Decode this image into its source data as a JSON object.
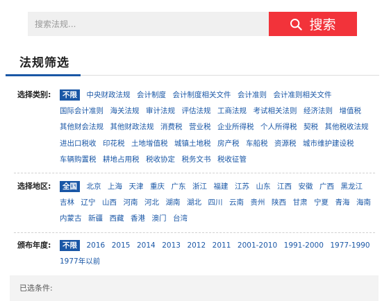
{
  "search": {
    "placeholder": "搜索法规...",
    "button_label": "搜索"
  },
  "filter_title": "法规筛选",
  "categories": {
    "label": "选择类别:",
    "options": [
      "不限",
      "中央财政法规",
      "会计制度",
      "会计制度相关文件",
      "会计准则",
      "会计准则相关文件",
      "国际会计准则",
      "海关法规",
      "审计法规",
      "评估法规",
      "工商法规",
      "考试相关法则",
      "经济法则",
      "增值税",
      "其他财会法规",
      "其他财政法规",
      "消费税",
      "营业税",
      "企业所得税",
      "个人所得税",
      "契税",
      "其他税收法规",
      "进出口税收",
      "印花税",
      "土地增值税",
      "城镇土地税",
      "房产税",
      "车船税",
      "资源税",
      "城市维护建设税",
      "车辆购置税",
      "耕地占用税",
      "税收协定",
      "税务文书",
      "税收征管"
    ],
    "selected": "不限"
  },
  "regions": {
    "label": "选择地区:",
    "options": [
      "全国",
      "北京",
      "上海",
      "天津",
      "重庆",
      "广东",
      "浙江",
      "福建",
      "江苏",
      "山东",
      "江西",
      "安徽",
      "广西",
      "黑龙江",
      "吉林",
      "辽宁",
      "山西",
      "河南",
      "河北",
      "湖南",
      "湖北",
      "四川",
      "云南",
      "贵州",
      "陕西",
      "甘肃",
      "宁夏",
      "青海",
      "海南",
      "内蒙古",
      "新疆",
      "西藏",
      "香港",
      "澳门",
      "台湾"
    ],
    "selected": "全国"
  },
  "years": {
    "label": "颁布年度:",
    "options": [
      "不限",
      "2016",
      "2015",
      "2014",
      "2013",
      "2012",
      "2011",
      "2001-2010",
      "1991-2000",
      "1977-1990",
      "1977年以前"
    ],
    "selected": "不限"
  },
  "selected_conditions_label": "已选条件:"
}
